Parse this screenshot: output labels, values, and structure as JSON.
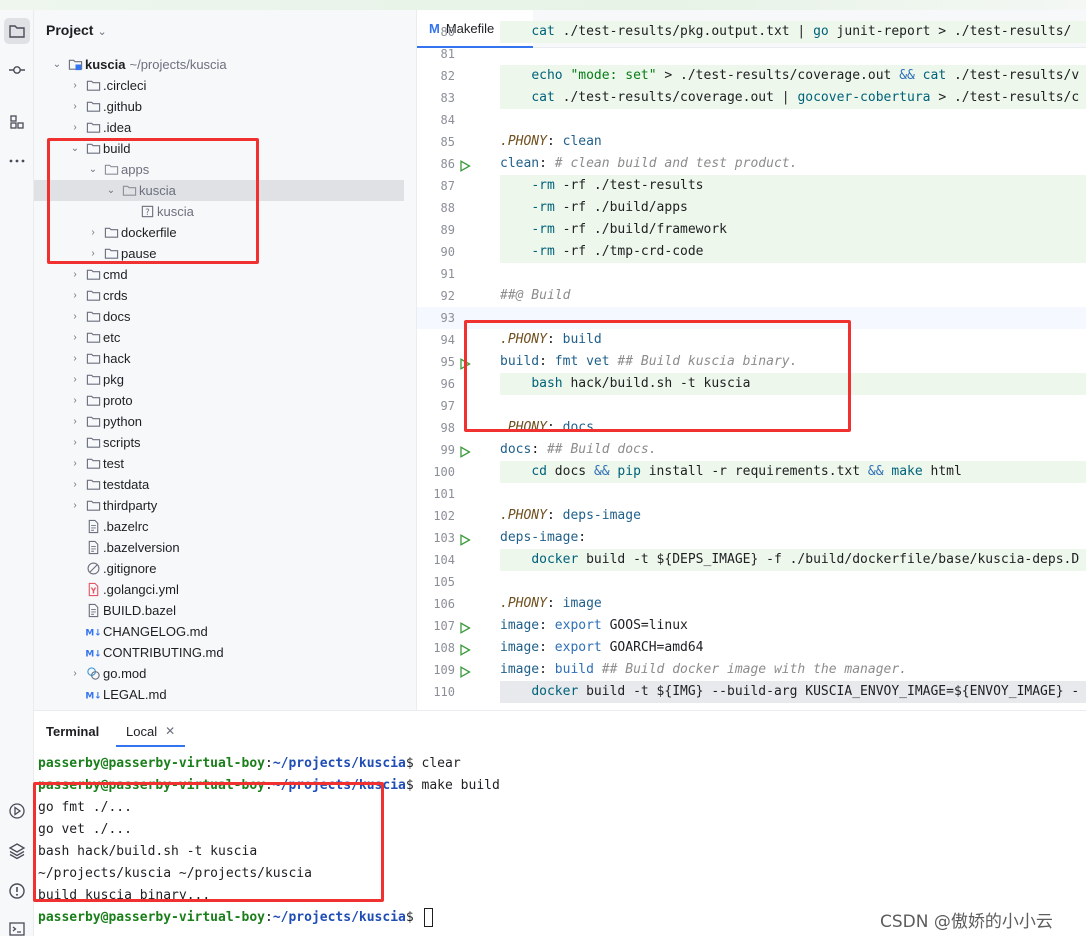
{
  "project_panel": {
    "title": "Project",
    "root": {
      "name": "kuscia",
      "path": "~/projects/kuscia"
    },
    "items": [
      {
        "label": "kuscia",
        "level": 0,
        "type": "root",
        "expanded": true
      },
      {
        "label": ".circleci",
        "level": 1,
        "type": "folder",
        "expanded": false
      },
      {
        "label": ".github",
        "level": 1,
        "type": "folder",
        "expanded": false
      },
      {
        "label": ".idea",
        "level": 1,
        "type": "folder",
        "expanded": false
      },
      {
        "label": "build",
        "level": 1,
        "type": "folder",
        "expanded": true
      },
      {
        "label": "apps",
        "level": 2,
        "type": "folder-excluded",
        "expanded": true
      },
      {
        "label": "kuscia",
        "level": 3,
        "type": "folder-excluded",
        "expanded": true
      },
      {
        "label": "kuscia",
        "level": 4,
        "type": "unknown-file",
        "expanded": false
      },
      {
        "label": "dockerfile",
        "level": 2,
        "type": "folder",
        "expanded": false
      },
      {
        "label": "pause",
        "level": 2,
        "type": "folder",
        "expanded": false
      },
      {
        "label": "cmd",
        "level": 1,
        "type": "folder",
        "expanded": false
      },
      {
        "label": "crds",
        "level": 1,
        "type": "folder",
        "expanded": false
      },
      {
        "label": "docs",
        "level": 1,
        "type": "folder",
        "expanded": false
      },
      {
        "label": "etc",
        "level": 1,
        "type": "folder",
        "expanded": false
      },
      {
        "label": "hack",
        "level": 1,
        "type": "folder",
        "expanded": false
      },
      {
        "label": "pkg",
        "level": 1,
        "type": "folder",
        "expanded": false
      },
      {
        "label": "proto",
        "level": 1,
        "type": "folder",
        "expanded": false
      },
      {
        "label": "python",
        "level": 1,
        "type": "folder",
        "expanded": false
      },
      {
        "label": "scripts",
        "level": 1,
        "type": "folder",
        "expanded": false
      },
      {
        "label": "test",
        "level": 1,
        "type": "folder",
        "expanded": false
      },
      {
        "label": "testdata",
        "level": 1,
        "type": "folder",
        "expanded": false
      },
      {
        "label": "thirdparty",
        "level": 1,
        "type": "folder",
        "expanded": false
      },
      {
        "label": ".bazelrc",
        "level": 1,
        "type": "text-file"
      },
      {
        "label": ".bazelversion",
        "level": 1,
        "type": "text-file"
      },
      {
        "label": ".gitignore",
        "level": 1,
        "type": "ignore-file"
      },
      {
        "label": ".golangci.yml",
        "level": 1,
        "type": "yaml-file"
      },
      {
        "label": "BUILD.bazel",
        "level": 1,
        "type": "text-file"
      },
      {
        "label": "CHANGELOG.md",
        "level": 1,
        "type": "md-file"
      },
      {
        "label": "CONTRIBUTING.md",
        "level": 1,
        "type": "md-file"
      },
      {
        "label": "go.mod",
        "level": 1,
        "type": "gomod-file",
        "expandable": true
      },
      {
        "label": "LEGAL.md",
        "level": 1,
        "type": "md-file"
      }
    ],
    "selected_index": 6
  },
  "editor": {
    "tab": {
      "label": "Makefile",
      "icon": "makefile-icon"
    },
    "lines": [
      {
        "n": "80",
        "run": false,
        "bg": "green",
        "tokens": [
          [
            "    ",
            "def"
          ],
          [
            "cat",
            "fn"
          ],
          [
            " ./test-results/pkg.output.txt | ",
            "def"
          ],
          [
            "go",
            "fn"
          ],
          [
            " junit-report > ./test-results/",
            "def"
          ]
        ]
      },
      {
        "n": "81",
        "run": false,
        "bg": "none",
        "tokens": []
      },
      {
        "n": "82",
        "run": false,
        "bg": "green",
        "tokens": [
          [
            "    ",
            "def"
          ],
          [
            "echo",
            "fn"
          ],
          [
            " ",
            "def"
          ],
          [
            "\"mode: set\"",
            "str"
          ],
          [
            " > ./test-results/coverage.out ",
            "def"
          ],
          [
            "&&",
            "kw"
          ],
          [
            " ",
            "def"
          ],
          [
            "cat",
            "fn"
          ],
          [
            " ./test-results/v",
            "def"
          ]
        ]
      },
      {
        "n": "83",
        "run": false,
        "bg": "green",
        "tokens": [
          [
            "    ",
            "def"
          ],
          [
            "cat",
            "fn"
          ],
          [
            " ./test-results/coverage.out | ",
            "def"
          ],
          [
            "gocover-cobertura",
            "fn"
          ],
          [
            " > ./test-results/c",
            "def"
          ]
        ]
      },
      {
        "n": "84",
        "run": false,
        "bg": "none",
        "tokens": []
      },
      {
        "n": "85",
        "run": false,
        "bg": "none",
        "tokens": [
          [
            ".PHONY",
            "ph"
          ],
          [
            ": ",
            "def"
          ],
          [
            "clean",
            "tgt"
          ]
        ]
      },
      {
        "n": "86",
        "run": true,
        "bg": "none",
        "tokens": [
          [
            "clean",
            "tgt"
          ],
          [
            ": ",
            "def"
          ],
          [
            "# clean build and test product.",
            "cm"
          ]
        ]
      },
      {
        "n": "87",
        "run": false,
        "bg": "green",
        "tokens": [
          [
            "    ",
            "def"
          ],
          [
            "-rm",
            "fn"
          ],
          [
            " -rf ./test-results",
            "def"
          ]
        ]
      },
      {
        "n": "88",
        "run": false,
        "bg": "green",
        "tokens": [
          [
            "    ",
            "def"
          ],
          [
            "-rm",
            "fn"
          ],
          [
            " -rf ./build/apps",
            "def"
          ]
        ]
      },
      {
        "n": "89",
        "run": false,
        "bg": "green",
        "tokens": [
          [
            "    ",
            "def"
          ],
          [
            "-rm",
            "fn"
          ],
          [
            " -rf ./build/framework",
            "def"
          ]
        ]
      },
      {
        "n": "90",
        "run": false,
        "bg": "green",
        "tokens": [
          [
            "    ",
            "def"
          ],
          [
            "-rm",
            "fn"
          ],
          [
            " -rf ./tmp-crd-code",
            "def"
          ]
        ]
      },
      {
        "n": "91",
        "run": false,
        "bg": "none",
        "tokens": []
      },
      {
        "n": "92",
        "run": false,
        "bg": "none",
        "tokens": [
          [
            "##@ Build",
            "cm"
          ]
        ]
      },
      {
        "n": "93",
        "run": false,
        "bg": "current",
        "tokens": []
      },
      {
        "n": "94",
        "run": false,
        "bg": "none",
        "tokens": [
          [
            ".PHONY",
            "ph"
          ],
          [
            ": ",
            "def"
          ],
          [
            "build",
            "tgt"
          ]
        ]
      },
      {
        "n": "95",
        "run": true,
        "bg": "none",
        "tokens": [
          [
            "build",
            "tgt"
          ],
          [
            ": ",
            "def"
          ],
          [
            "fmt vet",
            "tgt"
          ],
          [
            " ",
            "def"
          ],
          [
            "## Build kuscia binary.",
            "cm"
          ]
        ]
      },
      {
        "n": "96",
        "run": false,
        "bg": "green",
        "tokens": [
          [
            "    ",
            "def"
          ],
          [
            "bash",
            "fn"
          ],
          [
            " hack/build.sh -t kuscia",
            "def"
          ]
        ]
      },
      {
        "n": "97",
        "run": false,
        "bg": "none",
        "tokens": []
      },
      {
        "n": "98",
        "run": false,
        "bg": "none",
        "tokens": [
          [
            ".PHONY",
            "ph"
          ],
          [
            ": ",
            "def"
          ],
          [
            "docs",
            "tgt"
          ]
        ]
      },
      {
        "n": "99",
        "run": true,
        "bg": "none",
        "tokens": [
          [
            "docs",
            "tgt"
          ],
          [
            ": ",
            "def"
          ],
          [
            "## Build docs.",
            "cm"
          ]
        ]
      },
      {
        "n": "100",
        "run": false,
        "bg": "green",
        "tokens": [
          [
            "    ",
            "def"
          ],
          [
            "cd",
            "fn"
          ],
          [
            " docs ",
            "def"
          ],
          [
            "&&",
            "kw"
          ],
          [
            " ",
            "def"
          ],
          [
            "pip",
            "fn"
          ],
          [
            " install -r requirements.txt ",
            "def"
          ],
          [
            "&&",
            "kw"
          ],
          [
            " ",
            "def"
          ],
          [
            "make",
            "fn"
          ],
          [
            " html",
            "def"
          ]
        ]
      },
      {
        "n": "101",
        "run": false,
        "bg": "none",
        "tokens": []
      },
      {
        "n": "102",
        "run": false,
        "bg": "none",
        "tokens": [
          [
            ".PHONY",
            "ph"
          ],
          [
            ": ",
            "def"
          ],
          [
            "deps-image",
            "tgt"
          ]
        ]
      },
      {
        "n": "103",
        "run": true,
        "bg": "none",
        "tokens": [
          [
            "deps-image",
            "tgt"
          ],
          [
            ":",
            "def"
          ]
        ]
      },
      {
        "n": "104",
        "run": false,
        "bg": "green",
        "tokens": [
          [
            "    ",
            "def"
          ],
          [
            "docker",
            "fn"
          ],
          [
            " build -t ${DEPS_IMAGE} -f ./build/dockerfile/base/kuscia-deps.D",
            "def"
          ]
        ]
      },
      {
        "n": "105",
        "run": false,
        "bg": "none",
        "tokens": []
      },
      {
        "n": "106",
        "run": false,
        "bg": "none",
        "tokens": [
          [
            ".PHONY",
            "ph"
          ],
          [
            ": ",
            "def"
          ],
          [
            "image",
            "tgt"
          ]
        ]
      },
      {
        "n": "107",
        "run": true,
        "bg": "none",
        "tokens": [
          [
            "image",
            "tgt"
          ],
          [
            ": ",
            "def"
          ],
          [
            "export",
            "kw"
          ],
          [
            " GOOS=linux",
            "def"
          ]
        ]
      },
      {
        "n": "108",
        "run": true,
        "bg": "none",
        "tokens": [
          [
            "image",
            "tgt"
          ],
          [
            ": ",
            "def"
          ],
          [
            "export",
            "kw"
          ],
          [
            " GOARCH=amd64",
            "def"
          ]
        ]
      },
      {
        "n": "109",
        "run": true,
        "bg": "none",
        "tokens": [
          [
            "image",
            "tgt"
          ],
          [
            ": ",
            "def"
          ],
          [
            "build",
            "kw"
          ],
          [
            " ",
            "def"
          ],
          [
            "## Build docker image with the manager.",
            "cm"
          ]
        ]
      },
      {
        "n": "110",
        "run": false,
        "bg": "gray",
        "tokens": [
          [
            "    ",
            "def"
          ],
          [
            "docker",
            "fn"
          ],
          [
            " build -t ${IMG} --build-arg KUSCIA_ENVOY_IMAGE=${ENVOY_IMAGE} -",
            "def"
          ]
        ]
      }
    ]
  },
  "terminal": {
    "title": "Terminal",
    "tab_label": "Local",
    "prompt_user": "passerby@passerby-virtual-boy",
    "prompt_path": "~/projects/kuscia",
    "lines": [
      {
        "prompt": true,
        "cmd": " clear"
      },
      {
        "prompt": true,
        "cmd": " make build"
      },
      {
        "prompt": false,
        "text": "go fmt ./..."
      },
      {
        "prompt": false,
        "text": "go vet ./..."
      },
      {
        "prompt": false,
        "text": "bash hack/build.sh -t kuscia"
      },
      {
        "prompt": false,
        "text": "~/projects/kuscia ~/projects/kuscia"
      },
      {
        "prompt": false,
        "text": "build kuscia binary..."
      },
      {
        "prompt": true,
        "cmd": " ",
        "cursor": true
      }
    ],
    "watermark": "CSDN @傲娇的小小云"
  },
  "colors": {
    "annotation_red": "#f0312f",
    "accent_blue": "#3574f0",
    "run_green": "#3a9a3a"
  }
}
